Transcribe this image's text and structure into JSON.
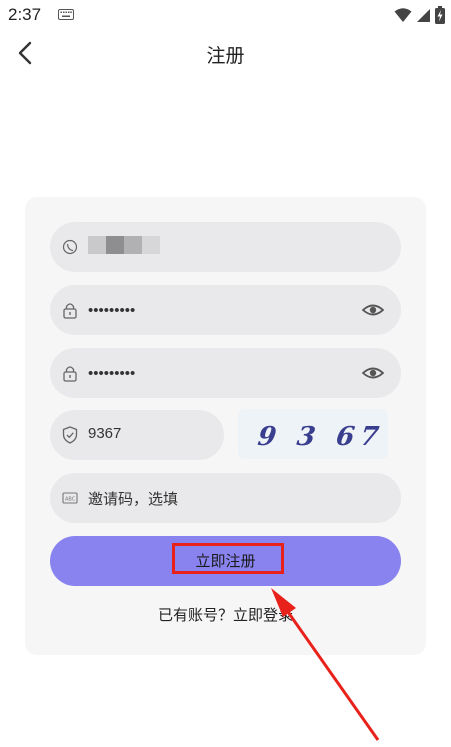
{
  "status_bar": {
    "time": "2:37"
  },
  "header": {
    "title": "注册"
  },
  "form": {
    "password_dots": "•••••••••",
    "confirm_dots": "•••••••••",
    "captcha_value": "9367",
    "captcha_image_text": "9 3 67",
    "invite_placeholder": "邀请码，选填"
  },
  "register_button": {
    "label": "立即注册"
  },
  "login_link": "已有账号？立即登录",
  "colors": {
    "accent": "#8883ee",
    "highlight_red": "#e8221b",
    "field_bg": "#e9e9eb",
    "card_bg": "#f6f6f7"
  }
}
